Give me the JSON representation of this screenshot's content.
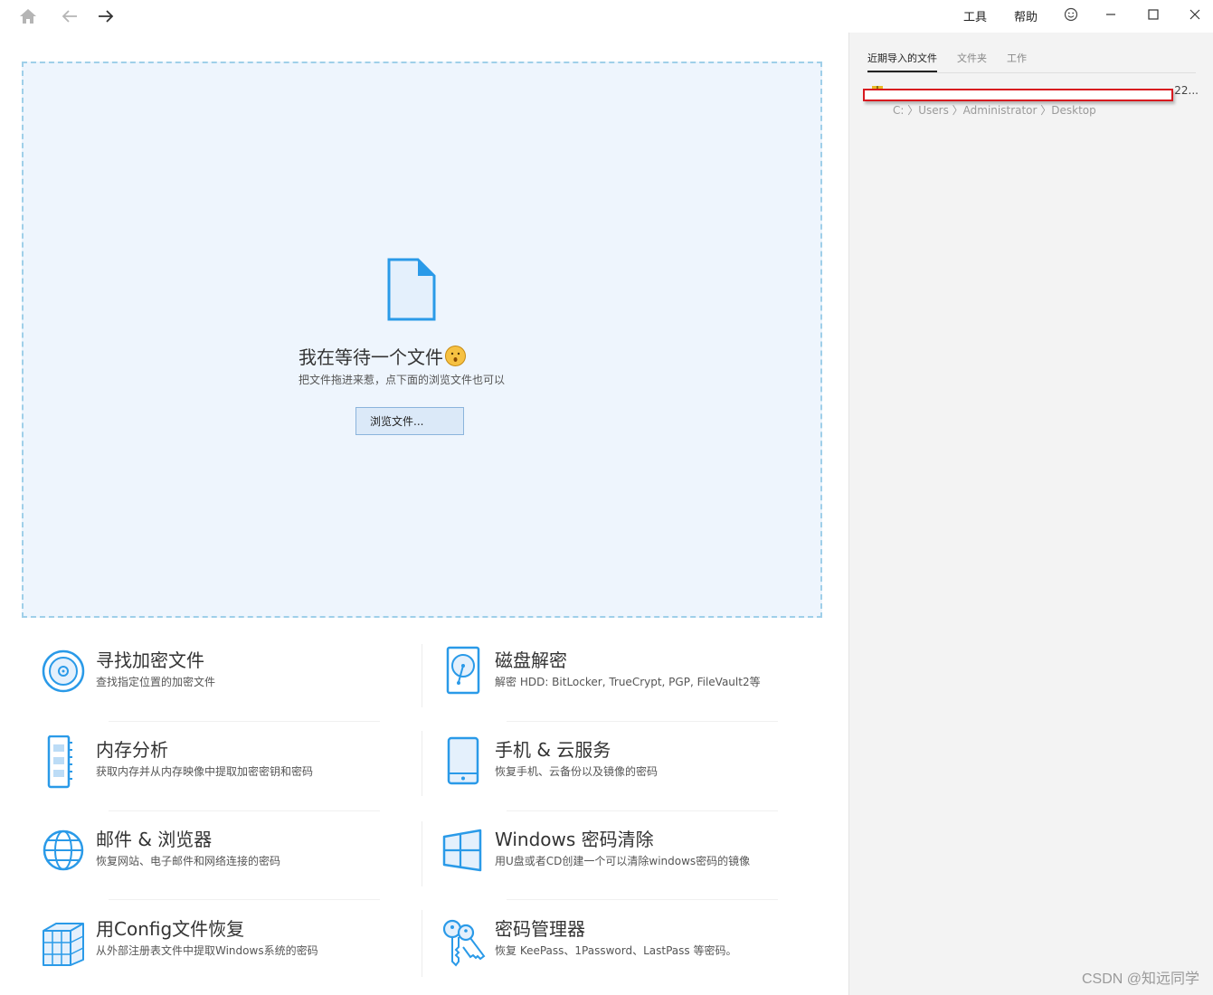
{
  "topbar": {
    "home_icon": "home-icon",
    "back_icon": "arrow-left-icon",
    "forward_icon": "arrow-right-icon",
    "menu": {
      "tools": "工具",
      "help": "帮助"
    },
    "feedback_icon": "smiley-icon",
    "window_controls": [
      "minimize-icon",
      "maximize-icon",
      "close-icon"
    ]
  },
  "dropzone": {
    "icon": "document-icon",
    "title": "我在等待一个文件",
    "subtitle": "把文件拖进来惹，点下面的浏览文件也可以",
    "browse_label": "浏览文件..."
  },
  "features": [
    {
      "id": "find-encrypted",
      "icon": "disc-icon",
      "title": "寻找加密文件",
      "desc": "查找指定位置的加密文件"
    },
    {
      "id": "disk-decrypt",
      "icon": "harddisk-icon",
      "title": "磁盘解密",
      "desc": "解密 HDD: BitLocker, TrueCrypt, PGP, FileVault2等"
    },
    {
      "id": "memory-analysis",
      "icon": "memory-icon",
      "title": "内存分析",
      "desc": "获取内存并从内存映像中提取加密密钥和密码"
    },
    {
      "id": "phone-cloud",
      "icon": "phone-icon",
      "title": "手机 & 云服务",
      "desc": "恢复手机、云备份以及镜像的密码"
    },
    {
      "id": "mail-browser",
      "icon": "globe-icon",
      "title": "邮件 & 浏览器",
      "desc": "恢复网站、电子邮件和网络连接的密码"
    },
    {
      "id": "windows-reset",
      "icon": "windows-icon",
      "title": "Windows 密码清除",
      "desc": "用U盘或者CD创建一个可以清除windows密码的镜像"
    },
    {
      "id": "config-recovery",
      "icon": "cubes-icon",
      "title": "用Config文件恢复",
      "desc": "从外部注册表文件中提取Windows系统的密码"
    },
    {
      "id": "password-manager",
      "icon": "keys-icon",
      "title": "密码管理器",
      "desc": "恢复 KeePass、1Password、LastPass 等密码。"
    }
  ],
  "sidebar": {
    "tabs": [
      "近期导入的文件",
      "文件夹",
      "工作"
    ],
    "active_tab": 0,
    "recent": [
      {
        "name": "...22...",
        "path": "C: 〉Users 〉Administrator 〉Desktop",
        "icon": "zip-file-icon"
      }
    ]
  },
  "watermark": "CSDN @知远同学",
  "colors": {
    "accent": "#2a9ae8",
    "dropzone_bg": "#eef5fd",
    "dropzone_border": "#9fcfe9",
    "sidebar_bg": "#f3f3f3",
    "redact_border": "#d8191f"
  }
}
